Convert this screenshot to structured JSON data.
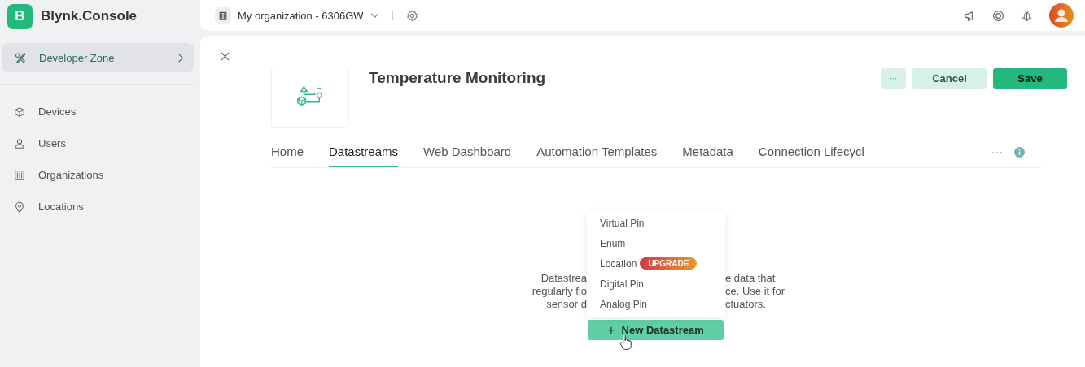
{
  "brand": {
    "letter": "B",
    "name": "Blynk.Console"
  },
  "org": {
    "label": "My organization - 6306GW"
  },
  "sidebar": {
    "zone": {
      "label": "Developer Zone",
      "selected": true
    },
    "items": [
      {
        "kind": "devices",
        "label": "Devices",
        "selected": false
      },
      {
        "kind": "users",
        "label": "Users",
        "selected": false
      },
      {
        "kind": "organizations",
        "label": "Organizations",
        "selected": false
      },
      {
        "kind": "locations",
        "label": "Locations",
        "selected": false
      }
    ]
  },
  "template": {
    "title": "Temperature Monitoring"
  },
  "actions": {
    "more": "···",
    "cancel": "Cancel",
    "save": "Save"
  },
  "tabs": [
    {
      "label": "Home",
      "selected": false
    },
    {
      "label": "Datastreams",
      "selected": true
    },
    {
      "label": "Web Dashboard",
      "selected": false
    },
    {
      "label": "Automation Templates",
      "selected": false
    },
    {
      "label": "Metadata",
      "selected": false
    },
    {
      "label": "Connection Lifecycl",
      "selected": false
    }
  ],
  "tabs_more": "···",
  "description_lines": [
    {
      "left": "Datastrea",
      "right": "e data that"
    },
    {
      "left": "regularly flo",
      "right": "ce. Use it for"
    },
    {
      "left": "sensor d",
      "right": "ctuators."
    }
  ],
  "menu": [
    {
      "label": "Virtual Pin"
    },
    {
      "label": "Enum"
    },
    {
      "label": "Location",
      "badge": "UPGRADE"
    },
    {
      "label": "Digital Pin"
    },
    {
      "label": "Analog Pin"
    }
  ],
  "new_button": {
    "icon": "+",
    "label": "New Datastream"
  }
}
